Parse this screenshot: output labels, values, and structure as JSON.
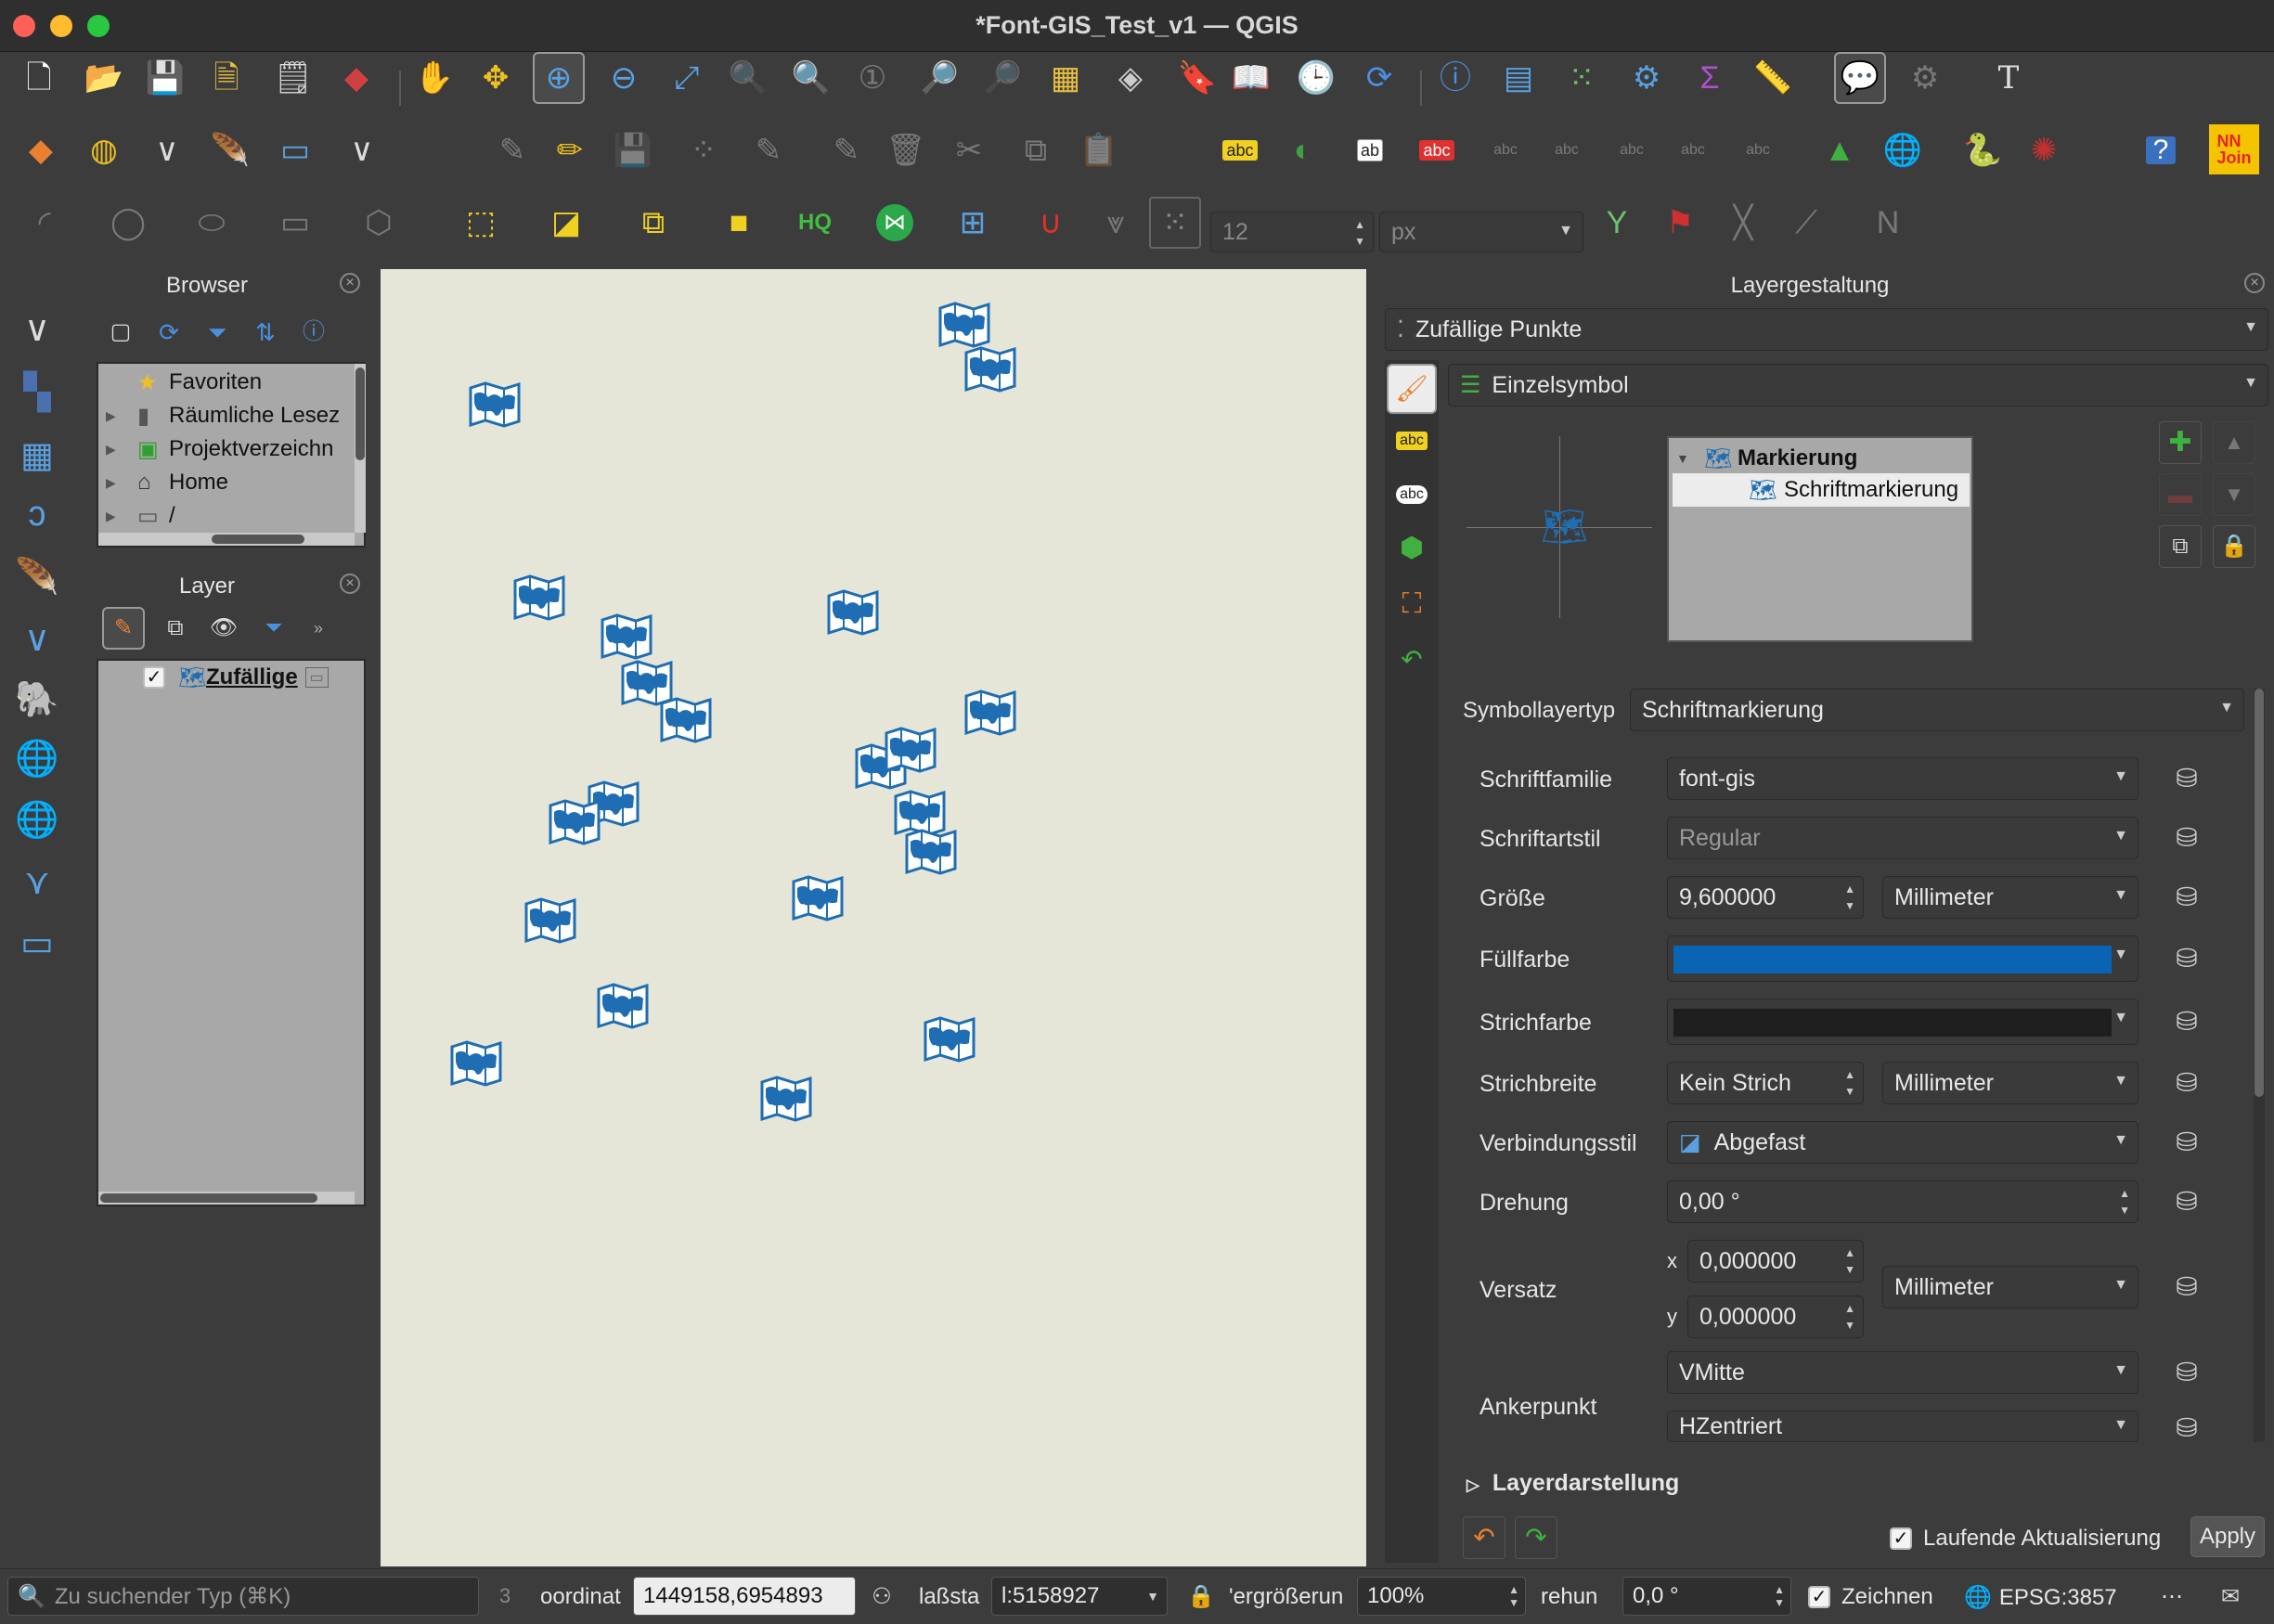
{
  "window": {
    "title": "*Font-GIS_Test_v1 — QGIS"
  },
  "browser": {
    "title": "Browser",
    "items": [
      {
        "label": "Favoriten",
        "icon": "star-icon"
      },
      {
        "label": "Räumliche Lesez",
        "icon": "bookmark-icon"
      },
      {
        "label": "Projektverzeichn",
        "icon": "project-folder-icon"
      },
      {
        "label": "Home",
        "icon": "home-icon"
      },
      {
        "label": "/",
        "icon": "folder-icon"
      }
    ]
  },
  "layers": {
    "title": "Layer",
    "items": [
      {
        "label": "Zufällige",
        "checked": true
      }
    ]
  },
  "styling": {
    "title": "Layergestaltung",
    "layer_select": "Zufällige Punkte",
    "renderer": "Einzelsymbol",
    "symbol_tree": {
      "parent": "Markierung",
      "child": "Schriftmarkierung"
    },
    "symbol_layer_type_label": "Symbollayertyp",
    "symbol_layer_type": "Schriftmarkierung",
    "font_family_label": "Schriftfamilie",
    "font_family": "font-gis",
    "font_style_label": "Schriftartstil",
    "font_style": "Regular",
    "size_label": "Größe",
    "size": "9,600000",
    "size_unit": "Millimeter",
    "fill_label": "Füllfarbe",
    "fill_color": "#0a64b4",
    "stroke_label": "Strichfarbe",
    "stroke_color": "#1e1e1e",
    "stroke_width_label": "Strichbreite",
    "stroke_width": "Kein Strich",
    "stroke_width_unit": "Millimeter",
    "join_label": "Verbindungsstil",
    "join": "Abgefast",
    "rotation_label": "Drehung",
    "rotation": "0,00 °",
    "offset_label": "Versatz",
    "offset_x_label": "x",
    "offset_x": "0,000000",
    "offset_y_label": "y",
    "offset_y": "0,000000",
    "offset_unit": "Millimeter",
    "anchor_label": "Ankerpunkt",
    "anchor_v": "VMitte",
    "anchor_h": "HZentriert",
    "layer_rendering": "Layerdarstellung",
    "live_update_label": "Laufende Aktualisierung",
    "live_update": true,
    "apply_label": "Apply"
  },
  "map": {
    "background": "#e6e6d8",
    "symbol_color": "#1f6db3"
  },
  "toolbar": {
    "font_size": "12",
    "font_unit": "px"
  },
  "status": {
    "search_placeholder": "Zu suchender Typ (⌘K)",
    "count": "3",
    "coordinate_label": "oordinat",
    "coordinate": "1449158,6954893",
    "scale_label": "laßsta",
    "scale": "l:5158927",
    "magnifier_label": "'ergrößerun",
    "magnifier": "100%",
    "rotation_label": "rehun",
    "rotation": "0,0 °",
    "render_label": "Zeichnen",
    "crs": "EPSG:3857"
  }
}
